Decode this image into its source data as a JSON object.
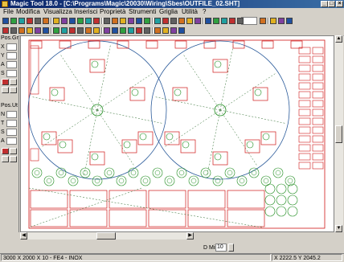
{
  "window": {
    "title": "Magic Tool 18.0 - [C:\\Programs\\Magic\\20030\\Wiring\\Sbes\\OUTFILE_02.SHT]",
    "controls": [
      "_",
      "□",
      "×"
    ]
  },
  "menu": [
    "File",
    "Modifica",
    "Visualizza",
    "Inserisci",
    "Proprietà",
    "Strumenti",
    "Griglia",
    "Utilità",
    "?"
  ],
  "toolbar": {
    "zoom_value": "",
    "rows": [
      [
        "new-icon",
        "open-icon",
        "save-icon",
        "print-icon",
        "cut-icon",
        "copy-icon",
        "paste-icon",
        "undo-icon",
        "redo-icon",
        "grid-icon",
        "snap-icon",
        "line-icon",
        "arc-icon",
        "circle-icon",
        "rect-icon",
        "polyline-icon",
        "text-icon",
        "dimension-icon",
        "hatch-icon",
        "layer-icon",
        "select-icon",
        "move-icon",
        "rotate-icon",
        "mirror-icon",
        "pointer-icon",
        "zoom-in-icon",
        "zoom-out-icon",
        "zoom-window-icon",
        "zoom-all-icon",
        "pan-icon",
        "redraw-icon",
        "properties-icon",
        "help-icon"
      ],
      [
        "nest-icon",
        "part-icon",
        "sheet-icon",
        "tool-icon",
        "punch-icon",
        "laser-icon",
        "cut-path-icon",
        "lead-in-icon",
        "micro-joint-icon",
        "bridge-icon",
        "order-icon",
        "simulate-icon",
        "optimize-icon",
        "report-icon",
        "export-icon",
        "import-icon",
        "cnc-icon",
        "postproc-icon",
        "measure-icon",
        "check-icon",
        "info-icon",
        "config-icon"
      ]
    ]
  },
  "left_panel": {
    "group1_title": "Pos.Gr",
    "group1_rows": [
      "X",
      "Y",
      "A",
      "S"
    ],
    "group2_title": "Pos.Ut",
    "group2_rows": [
      "N",
      "T",
      "S",
      "A"
    ]
  },
  "bottom_options": {
    "dmin_label": "D Min",
    "dmin_value": "10"
  },
  "status": {
    "sheet_info": "3000 X 2000 X 10 - FE4 - INOX",
    "coords": "X 2222.5  Y 2045.2"
  },
  "colors": {
    "part_red": "#d01818",
    "part_green": "#1a8a1a",
    "path_dashed": "#2a6a2a",
    "circle_blue": "#2a5a9a"
  }
}
